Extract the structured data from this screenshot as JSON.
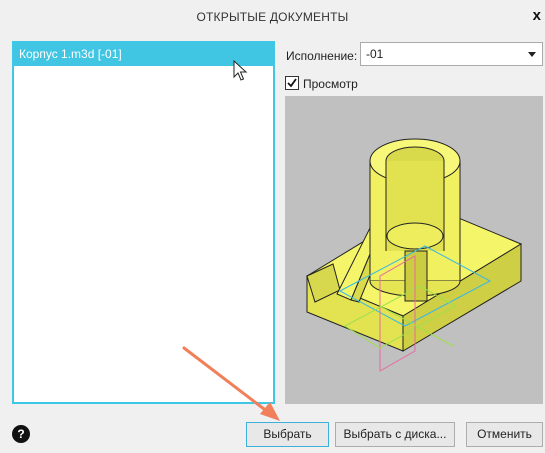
{
  "dialog": {
    "title": "ОТКРЫТЫЕ ДОКУМЕНТЫ",
    "close_label": "x"
  },
  "documents": {
    "items": [
      {
        "label": "Корпус 1.m3d [-01]",
        "selected": true
      }
    ]
  },
  "variant": {
    "label": "Исполнение:",
    "value": "-01"
  },
  "preview": {
    "label": "Просмотр",
    "checked": true
  },
  "footer": {
    "help_label": "?",
    "select_label": "Выбрать",
    "select_from_disk_label": "Выбрать с диска...",
    "cancel_label": "Отменить"
  },
  "colors": {
    "accent": "#40c5e3",
    "model_fill": "#f5f56a",
    "viewport_bg": "#c0c0c0",
    "annotation_arrow": "#f07f5a"
  },
  "icons": {
    "close": "close-icon",
    "help": "help-icon",
    "dropdown": "chevron-down-icon",
    "pointer": "mouse-pointer-icon"
  }
}
